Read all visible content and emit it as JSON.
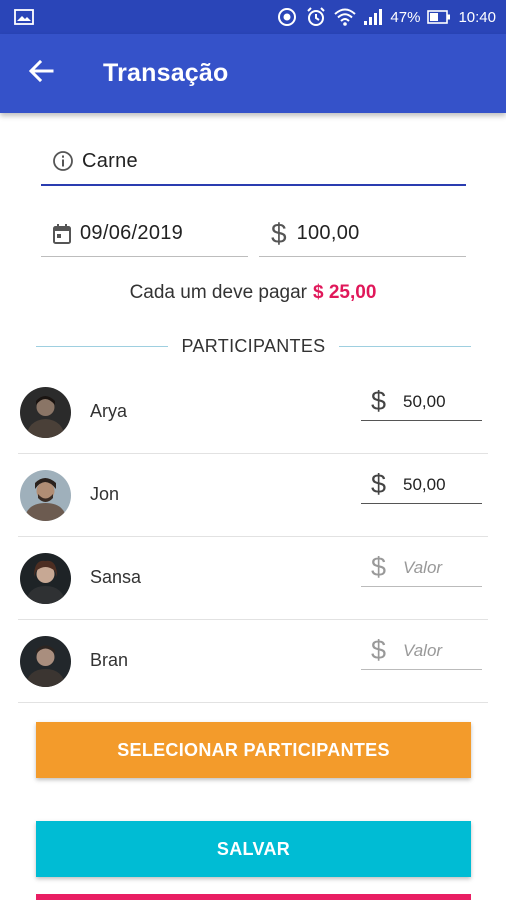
{
  "status_bar": {
    "battery_percent": "47%",
    "time": "10:40",
    "icons": [
      "image-icon",
      "sync-icon",
      "alarm-icon",
      "wifi-icon",
      "signal-icon",
      "battery-icon"
    ]
  },
  "app_bar": {
    "title": "Transação"
  },
  "form": {
    "description": "Carne",
    "date": "09/06/2019",
    "currency_symbol": "$",
    "total": "100,00"
  },
  "summary": {
    "text": "Cada um deve pagar",
    "amount": "$ 25,00"
  },
  "section_title": "PARTICIPANTES",
  "participants": [
    {
      "name": "Arya",
      "value": "50,00"
    },
    {
      "name": "Jon",
      "value": "50,00"
    },
    {
      "name": "Sansa",
      "value": "",
      "placeholder": "Valor"
    },
    {
      "name": "Bran",
      "value": "",
      "placeholder": "Valor"
    }
  ],
  "buttons": {
    "select_participants": "SELECIONAR PARTICIPANTES",
    "save": "SALVAR"
  },
  "colors": {
    "status_bar": "#2a45b8",
    "app_bar": "#3552c9",
    "accent_pink": "#e0185a",
    "select_button": "#f39b2b",
    "save_button": "#00bcd4",
    "bottom_button": "#e91e63"
  }
}
